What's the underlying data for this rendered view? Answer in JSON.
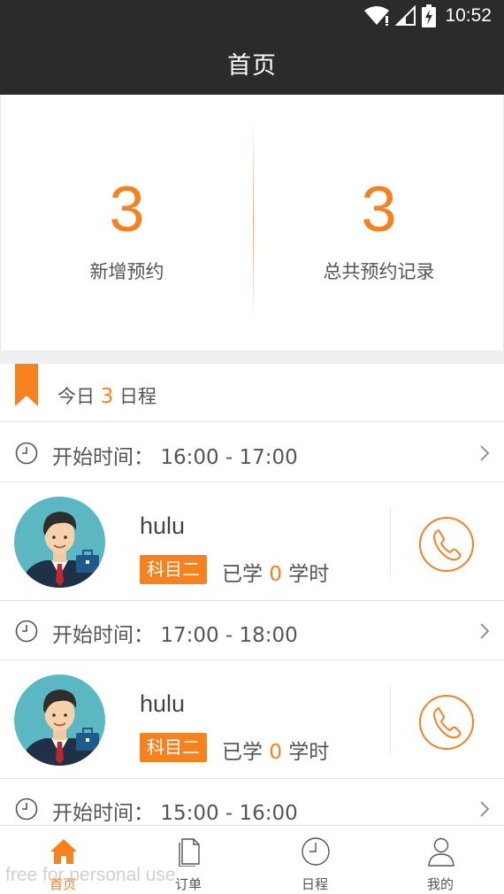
{
  "status_bar": {
    "time": "10:52",
    "icons": [
      "wifi-icon",
      "signal-icon",
      "battery-icon"
    ]
  },
  "header": {
    "title": "首页"
  },
  "stats": {
    "new_count": "3",
    "new_label": "新增预约",
    "total_count": "3",
    "total_label": "总共预约记录"
  },
  "today": {
    "prefix": "今日",
    "count": "3",
    "suffix": "日程"
  },
  "schedule": [
    {
      "time_label": "开始时间：",
      "time_range": "16:00 - 17:00",
      "student": {
        "name": "hulu",
        "subject": "科目二",
        "studied_prefix": "已学",
        "studied_hours": "0",
        "studied_suffix": "学时"
      }
    },
    {
      "time_label": "开始时间：",
      "time_range": "17:00 - 18:00",
      "student": {
        "name": "hulu",
        "subject": "科目二",
        "studied_prefix": "已学",
        "studied_hours": "0",
        "studied_suffix": "学时"
      }
    },
    {
      "time_label": "开始时间：",
      "time_range": "15:00 - 16:00"
    }
  ],
  "tabs": [
    {
      "label": "首页",
      "icon": "home-icon",
      "active": true
    },
    {
      "label": "订单",
      "icon": "document-icon",
      "active": false
    },
    {
      "label": "日程",
      "icon": "clock-icon",
      "active": false
    },
    {
      "label": "我的",
      "icon": "user-icon",
      "active": false
    }
  ],
  "watermark": "free for personal use",
  "colors": {
    "accent": "#f5821f",
    "header_bg": "#2b2b2b",
    "divider": "#e0e0e0"
  }
}
